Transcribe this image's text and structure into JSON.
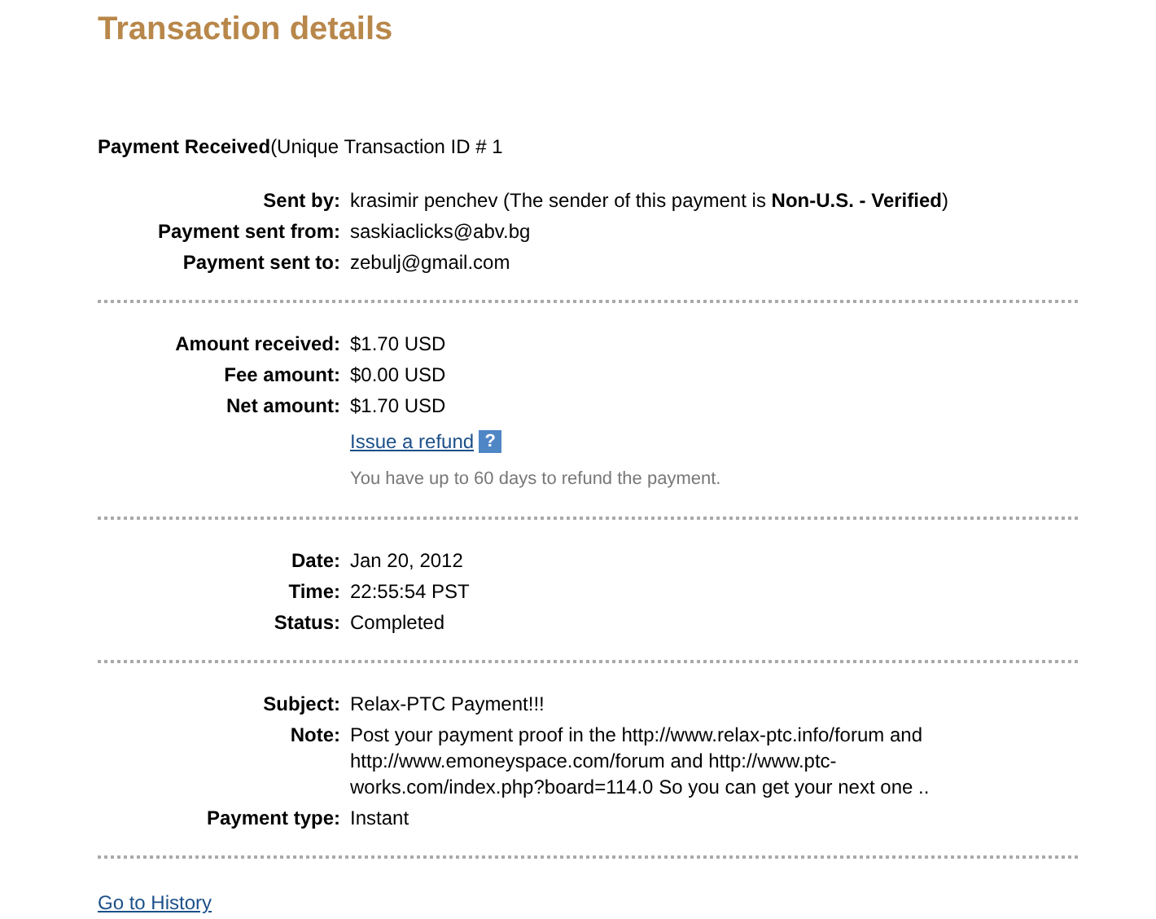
{
  "title": "Transaction details",
  "payment_heading": {
    "status": "Payment Received",
    "detail": "(Unique Transaction ID # 1"
  },
  "sections": [
    {
      "rows": [
        {
          "label": "Sent by:",
          "value": "krasimir penchev (The sender of this payment is **Non-U.S. - Verified**)"
        },
        {
          "label": "Payment sent from:",
          "value": "saskiaclicks@abv.bg"
        },
        {
          "label": "Payment sent to:",
          "value": "zebulj@gmail.com"
        }
      ]
    },
    {
      "rows": [
        {
          "label": "Amount received:",
          "value": "$1.70 USD"
        },
        {
          "label": "Fee amount:",
          "value": "$0.00 USD"
        },
        {
          "label": "Net amount:",
          "value": "$1.70 USD"
        }
      ],
      "refund": {
        "link": "Issue a refund",
        "help": "?",
        "hint": "You have up to 60 days to refund the payment."
      }
    },
    {
      "rows": [
        {
          "label": "Date:",
          "value": "Jan 20, 2012"
        },
        {
          "label": "Time:",
          "value": "22:55:54 PST"
        },
        {
          "label": "Status:",
          "value": "Completed"
        }
      ]
    },
    {
      "rows": [
        {
          "label": "Subject:",
          "value": "Relax-PTC Payment!!!"
        },
        {
          "label": "Note:",
          "value": "Post your payment proof in the http://www.relax-ptc.info/forum and\nhttp://www.emoneyspace.com/forum and http://www.ptc-\nworks.com/index.php?board=114.0 So you can get your next one .."
        },
        {
          "label": "Payment type:",
          "value": "Instant"
        }
      ]
    }
  ],
  "history_link": "Go to History"
}
